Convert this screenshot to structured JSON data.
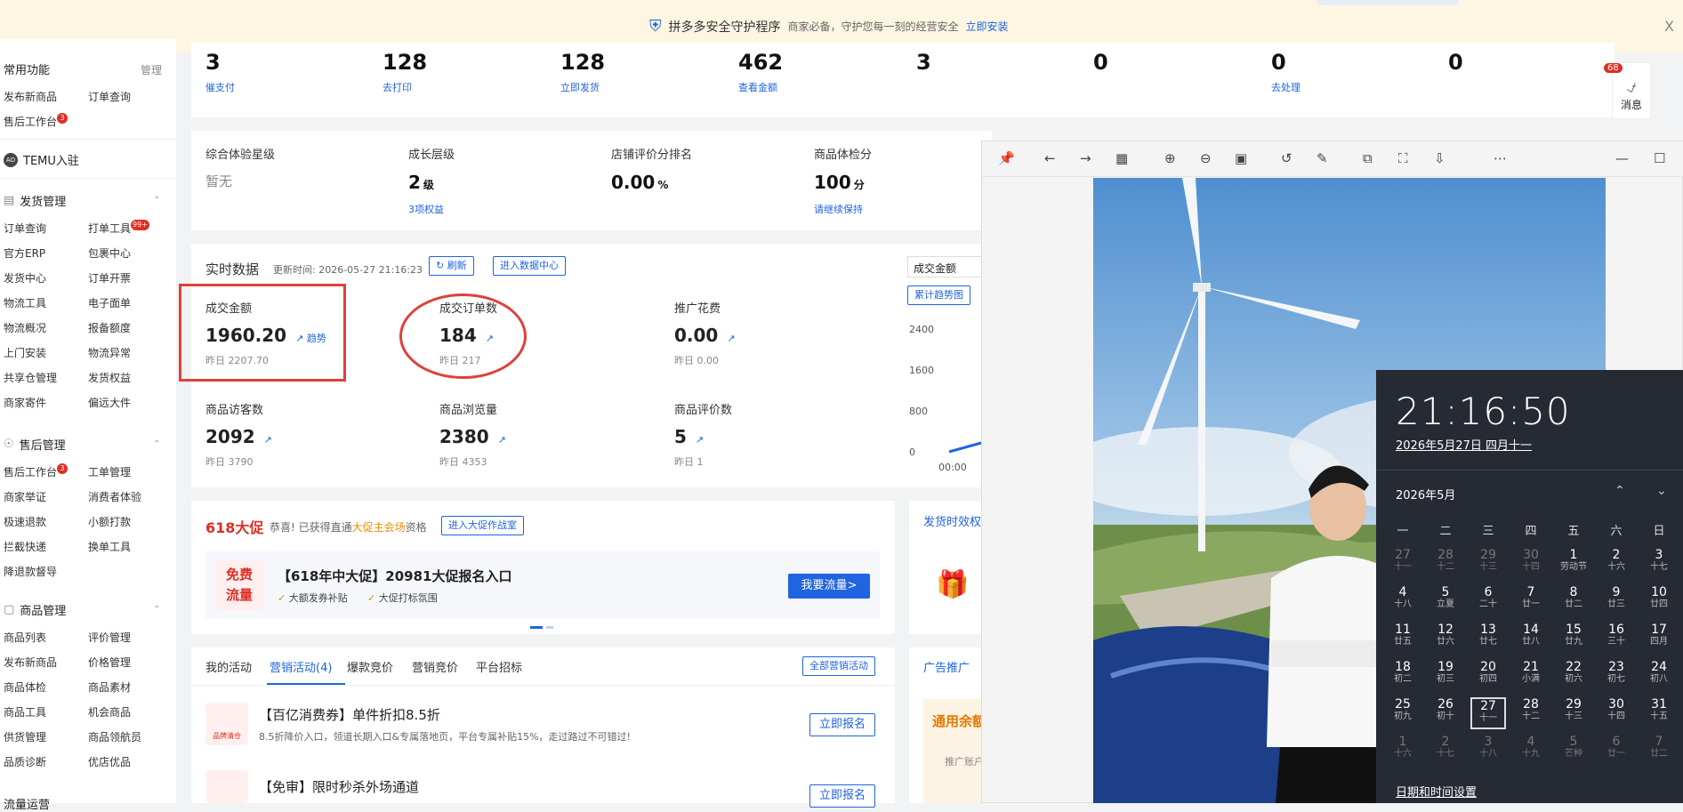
{
  "banner": {
    "title": "拼多多安全守护程序",
    "subtitle": "商家必备，守护您每一刻的经营安全",
    "link": "立即安装",
    "close": "X"
  },
  "sidebar": {
    "common": {
      "title": "常用功能",
      "manage": "管理",
      "items": [
        "发布新商品",
        "订单查询",
        "售后工作台"
      ],
      "badge": "3"
    },
    "temu": "TEMU入驻",
    "temu_icon": "AD",
    "shipping": {
      "title": "发货管理",
      "items": [
        "订单查询",
        "打单工具",
        "官方ERP",
        "包裹中心",
        "发货中心",
        "订单开票",
        "物流工具",
        "电子面单",
        "物流概况",
        "报备额度",
        "上门安装",
        "物流异常",
        "共享仓管理",
        "发货权益",
        "商家寄件",
        "偏远大件"
      ],
      "badge": "99+"
    },
    "aftersale": {
      "title": "售后管理",
      "items": [
        "售后工作台",
        "工单管理",
        "商家举证",
        "消费者体验",
        "极速退款",
        "小额打款",
        "拦截快递",
        "换单工具",
        "降退款督导"
      ],
      "badge": "3"
    },
    "goods": {
      "title": "商品管理",
      "items": [
        "商品列表",
        "评价管理",
        "发布新商品",
        "价格管理",
        "商品体检",
        "商品素材",
        "商品工具",
        "机会商品",
        "供货管理",
        "商品领航员",
        "品质诊断",
        "优店优品"
      ]
    },
    "traffic": {
      "title": "流量运营"
    }
  },
  "stats": [
    {
      "num": "3",
      "label": "催支付"
    },
    {
      "num": "128",
      "label": "去打印"
    },
    {
      "num": "128",
      "label": "立即发货"
    },
    {
      "num": "462",
      "label": "查看金额"
    },
    {
      "num": "3",
      "label": ""
    },
    {
      "num": "0",
      "label": ""
    },
    {
      "num": "0",
      "label": "去处理"
    },
    {
      "num": "0",
      "label": ""
    }
  ],
  "levels": [
    {
      "title": "综合体验星级",
      "value": "暂无",
      "unit": "",
      "link": ""
    },
    {
      "title": "成长层级",
      "value": "2",
      "unit": "级",
      "link": "3项权益"
    },
    {
      "title": "店铺评价分排名",
      "value": "0.00",
      "unit": "%",
      "link": ""
    },
    {
      "title": "商品体检分",
      "value": "100",
      "unit": "分",
      "link": "请继续保持"
    }
  ],
  "realtime": {
    "title": "实时数据",
    "updated": "更新时间: 2026-05-27 21:16:23",
    "refresh": "刷新",
    "data_center": "进入数据中心",
    "metric_select": "成交金额",
    "trend_btn": "累计趋势图",
    "metrics": [
      {
        "title": "成交金额",
        "value": "1960.20",
        "trend": "趋势",
        "yesterday": "昨日 2207.70"
      },
      {
        "title": "成交订单数",
        "value": "184",
        "trend": "",
        "yesterday": "昨日 217"
      },
      {
        "title": "推广花费",
        "value": "0.00",
        "trend": "",
        "yesterday": "昨日 0.00"
      },
      {
        "title": "商品访客数",
        "value": "2092",
        "trend": "",
        "yesterday": "昨日 3790"
      },
      {
        "title": "商品浏览量",
        "value": "2380",
        "trend": "",
        "yesterday": "昨日 4353"
      },
      {
        "title": "商品评价数",
        "value": "5",
        "trend": "",
        "yesterday": "昨日 1"
      }
    ],
    "chart_y": [
      "2400",
      "1600",
      "800",
      "0"
    ],
    "chart_x": "00:00"
  },
  "promo": {
    "logo": "618大促",
    "text1": "恭喜! 已获得直通",
    "text_hl": "大促主会场",
    "text2": "资格",
    "enter": "进入大促作战室",
    "badge_top": "免费",
    "badge_bottom": "流量",
    "headline": "【618年中大促】20981大促报名入口",
    "check1": "大额发券补贴",
    "check2": "大促打标氛围",
    "cta": "我要流量>",
    "ship_tab": "发货时效权"
  },
  "activities": {
    "tabs": [
      "我的活动",
      "营销活动(4)",
      "爆款竞价",
      "营销竞价",
      "平台招标"
    ],
    "all": "全部营销活动",
    "items": [
      {
        "icon_text": "品牌清仓",
        "title": "【百亿消费券】单件折扣8.5折",
        "desc": "8.5折降价入口，领道长期入口&专属落地页，平台专属补贴15%，走过路过不可错过!",
        "btn": "立即报名"
      },
      {
        "icon_text": "",
        "title": "【免审】限时秒杀外场通道",
        "desc": "",
        "btn": "立即报名"
      }
    ],
    "ad_tab": "广告推广",
    "ad_card_title": "通用余额",
    "ad_card_sub": "推广账户"
  },
  "message": {
    "label": "消息",
    "badge": "68"
  },
  "calendar": {
    "time": "21:16:50",
    "date": "2026年5月27日 四月十一",
    "month": "2026年5月",
    "weekdays": [
      "一",
      "二",
      "三",
      "四",
      "五",
      "六",
      "日"
    ],
    "days": [
      {
        "d": "27",
        "l": "十一",
        "dim": true
      },
      {
        "d": "28",
        "l": "十二",
        "dim": true
      },
      {
        "d": "29",
        "l": "十三",
        "dim": true
      },
      {
        "d": "30",
        "l": "十四",
        "dim": true
      },
      {
        "d": "1",
        "l": "劳动节"
      },
      {
        "d": "2",
        "l": "十六"
      },
      {
        "d": "3",
        "l": "十七"
      },
      {
        "d": "4",
        "l": "十八"
      },
      {
        "d": "5",
        "l": "立夏"
      },
      {
        "d": "6",
        "l": "二十"
      },
      {
        "d": "7",
        "l": "廿一"
      },
      {
        "d": "8",
        "l": "廿二"
      },
      {
        "d": "9",
        "l": "廿三"
      },
      {
        "d": "10",
        "l": "廿四"
      },
      {
        "d": "11",
        "l": "廿五"
      },
      {
        "d": "12",
        "l": "廿六"
      },
      {
        "d": "13",
        "l": "廿七"
      },
      {
        "d": "14",
        "l": "廿八"
      },
      {
        "d": "15",
        "l": "廿九"
      },
      {
        "d": "16",
        "l": "三十"
      },
      {
        "d": "17",
        "l": "四月"
      },
      {
        "d": "18",
        "l": "初二"
      },
      {
        "d": "19",
        "l": "初三"
      },
      {
        "d": "20",
        "l": "初四"
      },
      {
        "d": "21",
        "l": "小满"
      },
      {
        "d": "22",
        "l": "初六"
      },
      {
        "d": "23",
        "l": "初七"
      },
      {
        "d": "24",
        "l": "初八"
      },
      {
        "d": "25",
        "l": "初九"
      },
      {
        "d": "26",
        "l": "初十"
      },
      {
        "d": "27",
        "l": "十一",
        "today": true
      },
      {
        "d": "28",
        "l": "十二"
      },
      {
        "d": "29",
        "l": "十三"
      },
      {
        "d": "30",
        "l": "十四"
      },
      {
        "d": "31",
        "l": "十五"
      },
      {
        "d": "1",
        "l": "十六",
        "dim": true
      },
      {
        "d": "2",
        "l": "十七",
        "dim": true
      },
      {
        "d": "3",
        "l": "十八",
        "dim": true
      },
      {
        "d": "4",
        "l": "十九",
        "dim": true
      },
      {
        "d": "5",
        "l": "芒种",
        "dim": true
      },
      {
        "d": "6",
        "l": "廿一",
        "dim": true
      },
      {
        "d": "7",
        "l": "廿二",
        "dim": true
      }
    ],
    "footer": "日期和时间设置"
  },
  "colors": {
    "accent": "#1f64e0",
    "red": "#e02e24",
    "calendar_bg": "#262a33"
  }
}
